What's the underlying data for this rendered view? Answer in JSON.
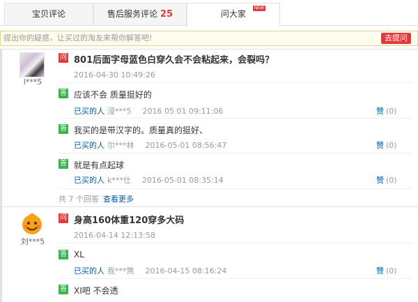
{
  "tabs": [
    {
      "label": "宝贝评论"
    },
    {
      "label": "售后服务评论",
      "count": "25"
    },
    {
      "label": "问大家",
      "badge": "NEW"
    }
  ],
  "ask": {
    "hint": "提出你的疑惑，让买过的淘友来帮你解答吧!",
    "button": "去提问"
  },
  "questions": [
    {
      "avatar_name": "l***5",
      "question": "801后面字母蓝色白穿久会不会粘起来，会裂吗？",
      "time": "2016-04-30 10:49:26",
      "answers": [
        {
          "text": "应该不会 质量挺好的",
          "who": "已买的人",
          "user": "浸***5",
          "date": "2016 05 01 09:11:06",
          "like_label": "赞",
          "like_count": "(0)"
        },
        {
          "text": "我买的是带汉字的。质量真的挺好、",
          "who": "已买的人",
          "user": "尔***林",
          "date": "2016-05-01 08:56:47",
          "like_label": "赞",
          "like_count": "(0)"
        },
        {
          "text": "就是有点起球",
          "who": "已买的人",
          "user": "k***仕",
          "date": "2016-05-01 08:35:14",
          "like_label": "赞",
          "like_count": "(0)"
        }
      ],
      "more_text": "共 7 个回答",
      "more_link": "查看更多"
    },
    {
      "avatar_name": "刘***5",
      "question": "身高160体重120穿多大码",
      "time": "2016-04-14 12:13:58",
      "answers": [
        {
          "text": "XL",
          "who": "已买的人",
          "user": "我***煞",
          "date": "2016-04-15 08:16:24",
          "like_label": "赞",
          "like_count": "(0)"
        },
        {
          "text": "XI吧 不会透"
        }
      ]
    }
  ],
  "tag_q": "问",
  "tag_a": "答",
  "colors": {
    "accent": "#e4393c",
    "answer_green": "#3cb34f",
    "link_blue": "#005ea7"
  }
}
